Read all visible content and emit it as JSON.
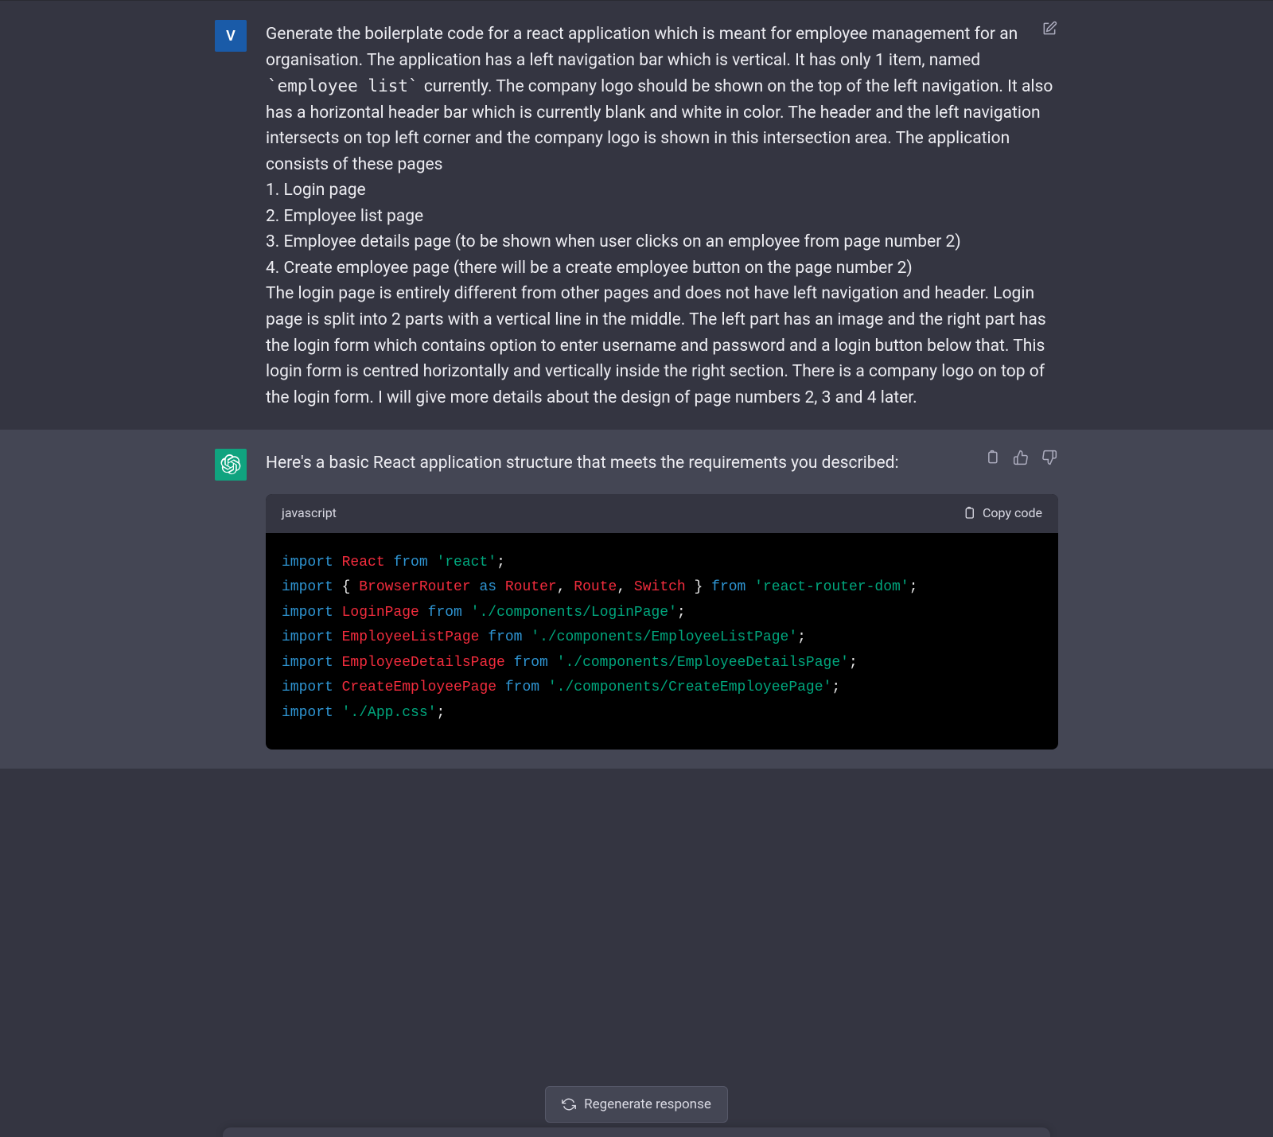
{
  "user": {
    "avatar_initial": "V",
    "prompt_before_code": "Generate the boilerplate code for a react application which is meant for employee management for an organisation. The application has a left navigation bar which is vertical. It has only 1 item, named ",
    "prompt_inline_code": "`employee list`",
    "prompt_after_code": " currently. The company logo should be shown on the top of the left navigation. It also has a horizontal header bar which is currently blank and white in color. The header and the left navigation intersects on top left corner and the company logo is shown in this intersection area. The application consists of these pages",
    "prompt_item_1": "1. Login page",
    "prompt_item_2": "2. Employee list page",
    "prompt_item_3": "3. Employee details page (to be shown when user clicks on an employee from page number 2)",
    "prompt_item_4": "4. Create employee page (there will be a create employee button on the page number 2)",
    "prompt_tail": "The login page is entirely different from other pages and does not have left navigation and header. Login page is split into 2 parts with a vertical line in the middle. The left part has an image and the right part has the login form which contains option to enter username and password and a login button below that. This login form is centred horizontally and vertically inside the right section. There is a company logo on top of the login form. I will give more details about the design of page numbers 2, 3 and 4 later."
  },
  "assistant": {
    "intro": "Here's a basic React application structure that meets the requirements you described:",
    "code_language": "javascript",
    "copy_label": "Copy code"
  },
  "code": {
    "l1_import": "import",
    "l1_react": " React ",
    "l1_from": "from",
    "l1_pkg": " 'react'",
    "l1_semi": ";",
    "l2_import": "import",
    "l2_braces_open": " { ",
    "l2_browserrouter": "BrowserRouter",
    "l2_as": " as ",
    "l2_router": "Router",
    "l2_c1": ", ",
    "l2_route": "Route",
    "l2_c2": ", ",
    "l2_switch": "Switch",
    "l2_braces_close": " } ",
    "l2_from": "from",
    "l2_pkg": " 'react-router-dom'",
    "l2_semi": ";",
    "l3": "",
    "l4_import": "import",
    "l4_name": " LoginPage ",
    "l4_from": "from",
    "l4_pkg": " './components/LoginPage'",
    "l4_semi": ";",
    "l5_import": "import",
    "l5_name": " EmployeeListPage ",
    "l5_from": "from",
    "l5_pkg": " './components/EmployeeListPage'",
    "l5_semi": ";",
    "l6_import": "import",
    "l6_name": " EmployeeDetailsPage ",
    "l6_from": "from",
    "l6_pkg": " './components/EmployeeDetailsPage'",
    "l6_semi": ";",
    "l7_import": "import",
    "l7_name": " CreateEmployeePage ",
    "l7_from": "from",
    "l7_pkg": " './components/CreateEmployeePage'",
    "l7_semi": ";",
    "l8": "",
    "l9_import": "import",
    "l9_pkg": " './App.css'",
    "l9_semi": ";"
  },
  "regenerate_label": "Regenerate response"
}
